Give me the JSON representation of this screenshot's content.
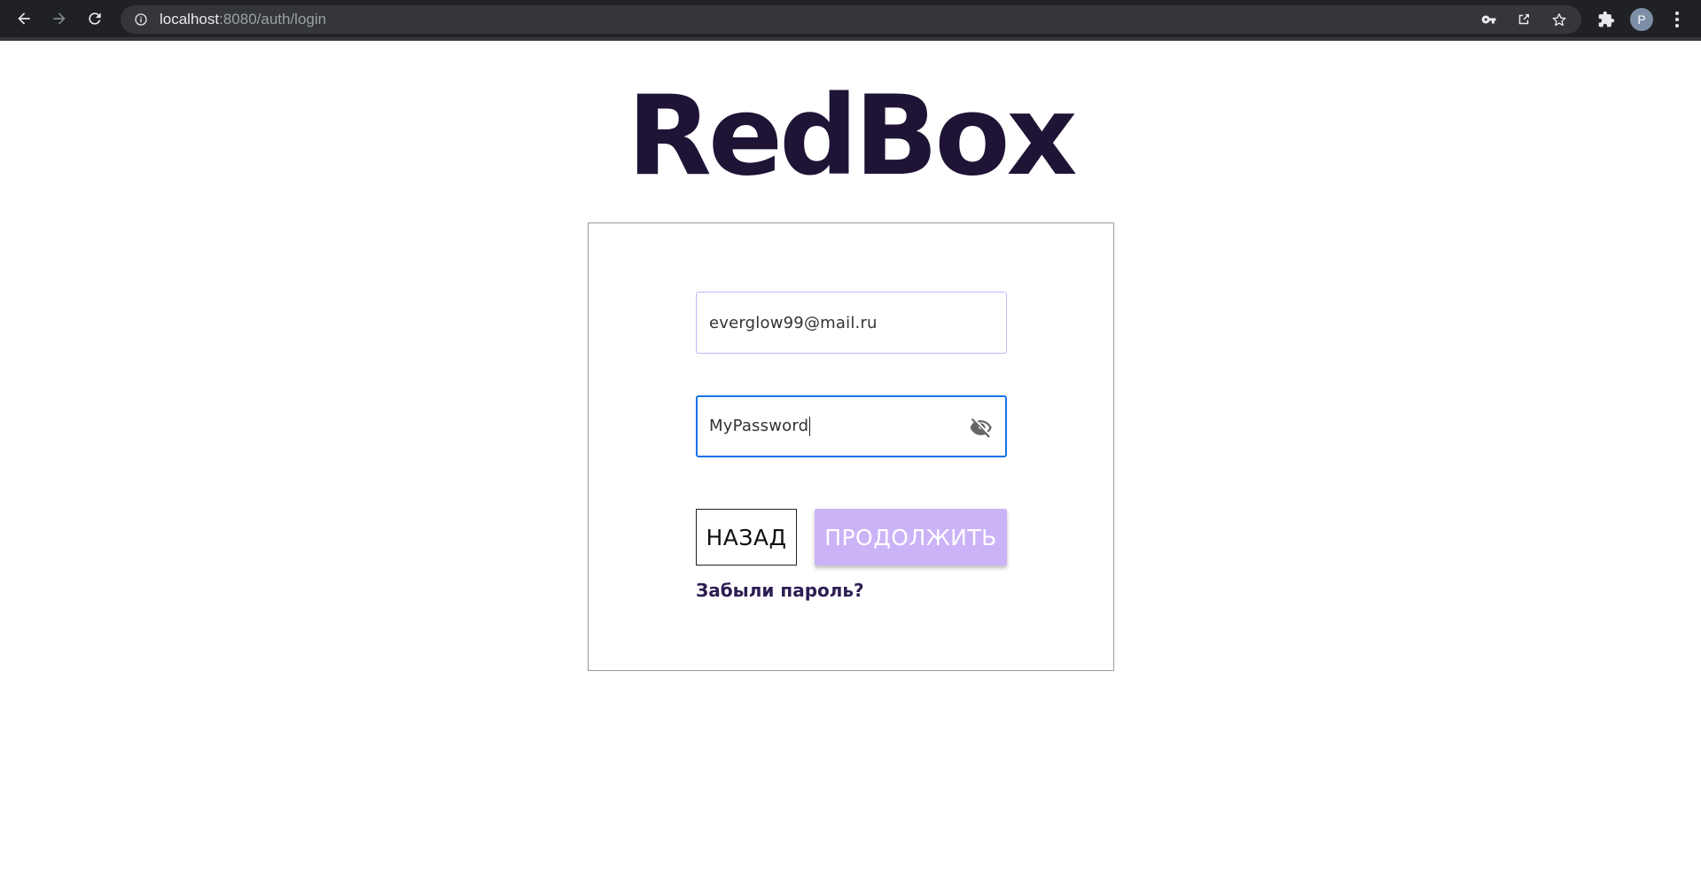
{
  "browser": {
    "url_host": "localhost",
    "url_rest": ":8080/auth/login",
    "avatar_letter": "P"
  },
  "page": {
    "logo": "RedBox",
    "email_value": "everglow99@mail.ru",
    "password_value": "MyPassword",
    "back_label": "НАЗАД",
    "continue_label": "ПРОДОЛЖИТЬ",
    "forgot_label": "Забыли пароль?"
  },
  "colors": {
    "brand": "#1f1436",
    "accent": "#cbb3f7",
    "focus": "#1a73e8"
  }
}
